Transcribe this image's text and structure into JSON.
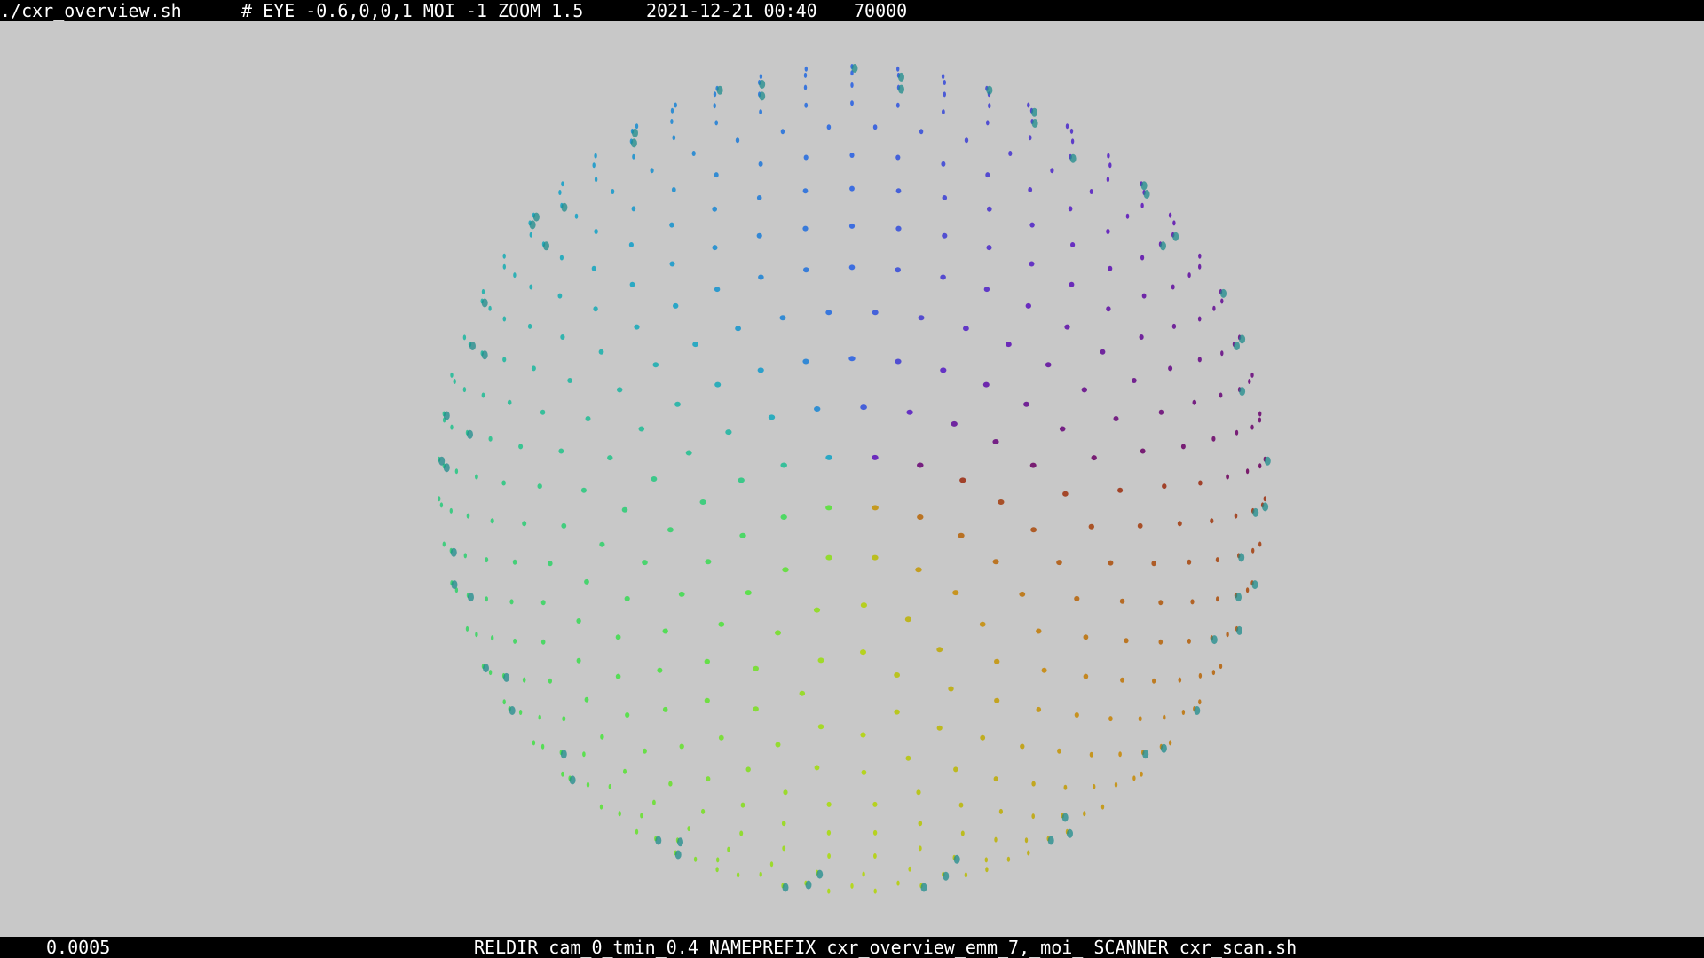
{
  "header": {
    "script": "./cxr_overview.sh",
    "params": "# EYE -0.6,0,0,1 MOI -1 ZOOM 1.5",
    "datetime": "2021-12-21 00:40",
    "count": "70000"
  },
  "footer": {
    "value": "0.0005",
    "params": "RELDIR cam_0_tmin_0.4 NAMEPREFIX cxr_overview_emm_7,_moi_ SCANNER cxr_scan.sh"
  },
  "scene": {
    "object": "sphere of sampled points",
    "background_color": "#c8c8c8",
    "colors": [
      "#7a1c6a",
      "#6a2cc0",
      "#3d6ee0",
      "#2aa6c8",
      "#3cc88a",
      "#58e050",
      "#b4d820",
      "#c89020",
      "#a0402a"
    ]
  }
}
